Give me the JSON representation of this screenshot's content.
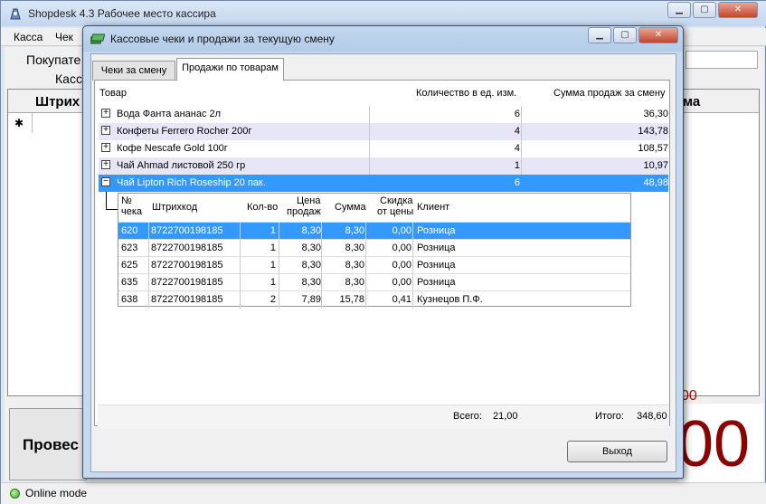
{
  "main": {
    "title": "Shopdesk 4.3 Рабочее место кассира",
    "menu": [
      "Касса",
      "Чек"
    ],
    "labels": {
      "customer": "Покупате",
      "cashier": "Касс"
    },
    "grid_headers": {
      "barcode": "Штрих",
      "sum": "ма"
    },
    "new_row_marker": "✱",
    "post_button": "Провес",
    "small_total": "00",
    "big_total": "00",
    "status": "Online mode"
  },
  "dialog": {
    "title": "Кассовые чеки и продажи за текущую смену",
    "tabs": [
      "Чеки за смену",
      "Продажи по товарам"
    ],
    "columns": {
      "product": "Товар",
      "qty": "Количество в ед. изм.",
      "sum": "Сумма продаж за смену"
    },
    "products": [
      {
        "name": "Вода Фанта ананас 2л",
        "qty": "6",
        "sum": "36,30",
        "expander": "+"
      },
      {
        "name": "Конфеты Ferrero Rocher 200г",
        "qty": "4",
        "sum": "143,78",
        "expander": "+"
      },
      {
        "name": "Кофе Nescafe Gold 100г",
        "qty": "4",
        "sum": "108,57",
        "expander": "+"
      },
      {
        "name": "Чай Ahmad листовой 250 гр",
        "qty": "1",
        "sum": "10,97",
        "expander": "+"
      },
      {
        "name": "Чай Lipton Rich Roseship 20 пак.",
        "qty": "6",
        "sum": "48,98",
        "expander": "−"
      }
    ],
    "detail_columns": {
      "check_no_1": "№",
      "check_no_2": "чека",
      "barcode": "Штрихкод",
      "qty": "Кол-во",
      "price_1": "Цена",
      "price_2": "продаж",
      "sum": "Сумма",
      "discount_1": "Скидка",
      "discount_2": "от цены",
      "client": "Клиент"
    },
    "details": [
      {
        "check": "620",
        "barcode": "8722700198185",
        "qty": "1",
        "price": "8,30",
        "sum": "8,30",
        "discount": "0,00",
        "client": "Розница"
      },
      {
        "check": "623",
        "barcode": "8722700198185",
        "qty": "1",
        "price": "8,30",
        "sum": "8,30",
        "discount": "0,00",
        "client": "Розница"
      },
      {
        "check": "625",
        "barcode": "8722700198185",
        "qty": "1",
        "price": "8,30",
        "sum": "8,30",
        "discount": "0,00",
        "client": "Розница"
      },
      {
        "check": "635",
        "barcode": "8722700198185",
        "qty": "1",
        "price": "8,30",
        "sum": "8,30",
        "discount": "0,00",
        "client": "Розница"
      },
      {
        "check": "638",
        "barcode": "8722700198185",
        "qty": "2",
        "price": "7,89",
        "sum": "15,78",
        "discount": "0,41",
        "client": "Кузнецов П.Ф."
      }
    ],
    "footer": {
      "total_label": "Всего:",
      "total_qty": "21,00",
      "grand_label": "Итого:",
      "grand_sum": "348,60"
    },
    "exit_button": "Выход"
  }
}
